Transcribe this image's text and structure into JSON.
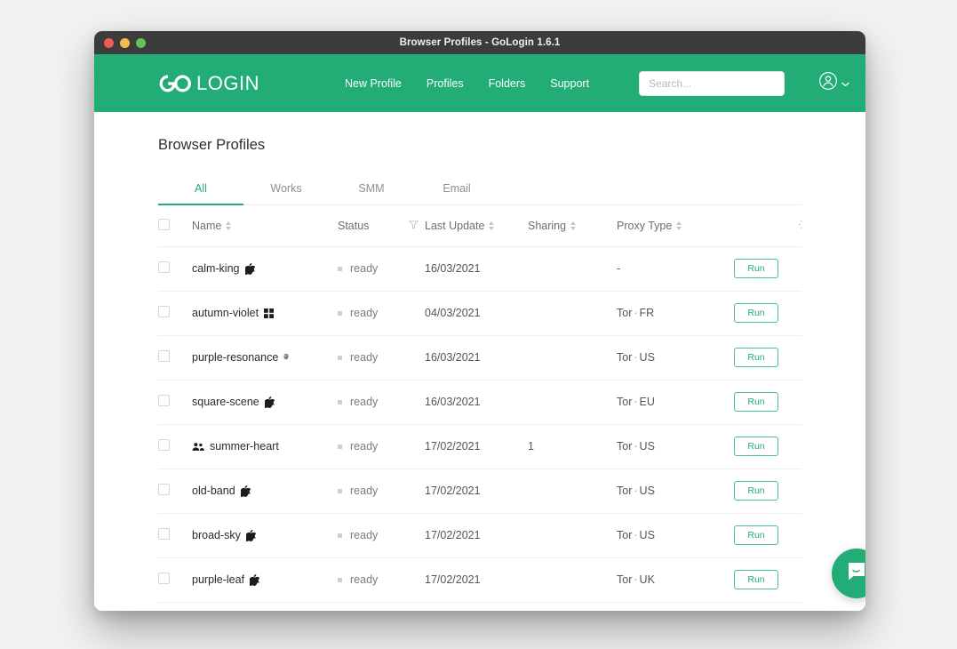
{
  "window": {
    "title": "Browser Profiles - GoLogin 1.6.1",
    "traffic_lights": [
      "close-red",
      "minimize-yellow",
      "maximize-green"
    ]
  },
  "header": {
    "brand": {
      "go": "GO",
      "login": "LOGIN"
    },
    "nav": [
      {
        "label": "New Profile",
        "name": "nav-new-profile"
      },
      {
        "label": "Profiles",
        "name": "nav-profiles"
      },
      {
        "label": "Folders",
        "name": "nav-folders"
      },
      {
        "label": "Support",
        "name": "nav-support"
      }
    ],
    "search": {
      "value": "",
      "placeholder": "Search..."
    },
    "account": {
      "icon": "user-circle-icon",
      "chevron": "chevron-down-icon"
    },
    "accent_color": "#22ad76"
  },
  "page": {
    "title": "Browser Profiles"
  },
  "tabs": [
    {
      "label": "All",
      "active": true
    },
    {
      "label": "Works",
      "active": false
    },
    {
      "label": "SMM",
      "active": false
    },
    {
      "label": "Email",
      "active": false
    }
  ],
  "table": {
    "columns": [
      {
        "label": "",
        "name": "select-all",
        "sortable": false
      },
      {
        "label": "Name",
        "name": "col-name",
        "sortable": true
      },
      {
        "label": "Status",
        "name": "col-status",
        "sortable": false,
        "filter": true
      },
      {
        "label": "Last Update",
        "name": "col-last-update",
        "sortable": true
      },
      {
        "label": "Sharing",
        "name": "col-sharing",
        "sortable": true
      },
      {
        "label": "Proxy Type",
        "name": "col-proxy-type",
        "sortable": true
      }
    ],
    "settings_icon": "gear-icon",
    "run_label": "Run",
    "rows": [
      {
        "name": "calm-king",
        "os": "apple",
        "shared": false,
        "status": "ready",
        "last_update": "16/03/2021",
        "sharing": "",
        "proxy": "-",
        "proxy_type": "",
        "proxy_country": ""
      },
      {
        "name": "autumn-violet",
        "os": "windows",
        "shared": false,
        "status": "ready",
        "last_update": "04/03/2021",
        "sharing": "",
        "proxy": "",
        "proxy_type": "Tor",
        "proxy_country": "FR"
      },
      {
        "name": "purple-resonance",
        "os": "other",
        "shared": false,
        "status": "ready",
        "last_update": "16/03/2021",
        "sharing": "",
        "proxy": "",
        "proxy_type": "Tor",
        "proxy_country": "US"
      },
      {
        "name": "square-scene",
        "os": "apple",
        "shared": false,
        "status": "ready",
        "last_update": "16/03/2021",
        "sharing": "",
        "proxy": "",
        "proxy_type": "Tor",
        "proxy_country": "EU"
      },
      {
        "name": "summer-heart",
        "os": "none",
        "shared": true,
        "status": "ready",
        "last_update": "17/02/2021",
        "sharing": "1",
        "proxy": "",
        "proxy_type": "Tor",
        "proxy_country": "US"
      },
      {
        "name": "old-band",
        "os": "apple",
        "shared": false,
        "status": "ready",
        "last_update": "17/02/2021",
        "sharing": "",
        "proxy": "",
        "proxy_type": "Tor",
        "proxy_country": "US"
      },
      {
        "name": "broad-sky",
        "os": "apple",
        "shared": false,
        "status": "ready",
        "last_update": "17/02/2021",
        "sharing": "",
        "proxy": "",
        "proxy_type": "Tor",
        "proxy_country": "US"
      },
      {
        "name": "purple-leaf",
        "os": "apple",
        "shared": false,
        "status": "ready",
        "last_update": "17/02/2021",
        "sharing": "",
        "proxy": "",
        "proxy_type": "Tor",
        "proxy_country": "UK"
      }
    ]
  },
  "chat": {
    "icon": "chat-bubble-icon",
    "color": "#22ad76"
  }
}
